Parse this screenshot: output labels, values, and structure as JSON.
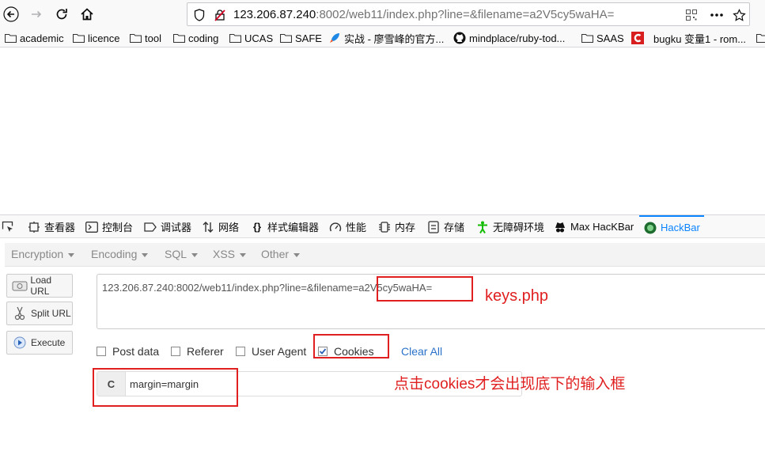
{
  "browser": {
    "url_host": "123.206.87.240",
    "url_rest": ":8002/web11/index.php?line=&filename=a2V5cy5waHA=",
    "back_icon": "arrow-left-icon",
    "forward_icon": "arrow-right-icon",
    "reload_icon": "reload-icon",
    "home_icon": "home-icon"
  },
  "bookmarks": [
    {
      "label": "academic",
      "icon": "folder-icon"
    },
    {
      "label": "licence",
      "icon": "folder-icon"
    },
    {
      "label": "tool",
      "icon": "folder-icon"
    },
    {
      "label": "coding",
      "icon": "folder-icon"
    },
    {
      "label": "UCAS",
      "icon": "folder-icon"
    },
    {
      "label": "SAFE",
      "icon": "folder-icon"
    },
    {
      "label": "实战 - 廖雪峰的官方...",
      "icon": "rocket-icon"
    },
    {
      "label": "mindplace/ruby-tod...",
      "icon": "github-icon"
    },
    {
      "label": "SAAS",
      "icon": "folder-icon"
    },
    {
      "label": "bugku 变量1 - rom...",
      "icon": "c-brand-icon"
    }
  ],
  "devtools": {
    "tabs": [
      {
        "label": "查看器"
      },
      {
        "label": "控制台"
      },
      {
        "label": "调试器"
      },
      {
        "label": "网络"
      },
      {
        "label": "样式编辑器"
      },
      {
        "label": "性能"
      },
      {
        "label": "内存"
      },
      {
        "label": "存储"
      },
      {
        "label": "无障碍环境"
      },
      {
        "label": "Max HacKBar"
      },
      {
        "label": "HackBar"
      }
    ],
    "active_color": "#0a84ff"
  },
  "hackbar": {
    "menu": [
      {
        "label": "Encryption"
      },
      {
        "label": "Encoding"
      },
      {
        "label": "SQL"
      },
      {
        "label": "XSS"
      },
      {
        "label": "Other"
      }
    ],
    "buttons": {
      "load": "Load URL",
      "split": "Split URL",
      "execute": "Execute"
    },
    "url_value": "123.206.87.240:8002/web11/index.php?line=&filename=a2V5cy5waHA=",
    "options": {
      "post_data": "Post data",
      "referer": "Referer",
      "user_agent": "User Agent",
      "cookies": "Cookies",
      "cookies_checked": true,
      "clear_all": "Clear All"
    },
    "cookie_tag": "C",
    "cookie_value": "margin=margin"
  },
  "annotations": {
    "keys": "keys.php",
    "note": "点击cookies才会出现底下的输入框",
    "color": "#e02020"
  }
}
